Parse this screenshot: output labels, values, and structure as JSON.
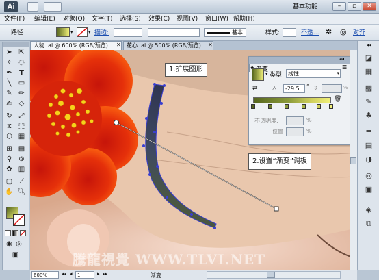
{
  "titlebar": {
    "logo": "Ai",
    "workspace_label": "基本功能",
    "minimize": "–",
    "restore": "▫",
    "close": "✕"
  },
  "menus": [
    "文件(F)",
    "编辑(E)",
    "对象(O)",
    "文字(T)",
    "选择(S)",
    "效果(C)",
    "视图(V)",
    "窗口(W)",
    "帮助(H)"
  ],
  "controlbar": {
    "object_label": "路径",
    "stroke_label": "描边:",
    "stroke_style": "基本",
    "style_label": "样式:",
    "opacity_label": "不透...",
    "align_label": "对齐"
  },
  "tabs": [
    {
      "label": "人物. ai @ 600% (RGB/预览)",
      "active": true
    },
    {
      "label": "花心. ai @ 500% (RGB/预览)",
      "active": false
    }
  ],
  "gradient_panel": {
    "title": "渐变",
    "type_label": "类型:",
    "type_value": "线性",
    "angle_value": "-29.5",
    "angle_unit": "°",
    "percent": "%",
    "opacity_label": "不透明度:",
    "location_label": "位置:",
    "colors": {
      "start": "#55651e",
      "end": "#f2f17a"
    }
  },
  "callouts": {
    "step1": "1.扩展图形",
    "step2": "2.设置“渐变”调板"
  },
  "statusbar": {
    "zoom": "600%",
    "page": "1",
    "status": "渐变"
  },
  "watermark": "騰龍視覺 WWW.TLVI.NET",
  "colors": {
    "flower_outer": "#ff5a0a",
    "flower_inner": "#d2200a",
    "path_stroke": "#3a3fd0",
    "accent_blue": "#2f63c8"
  }
}
